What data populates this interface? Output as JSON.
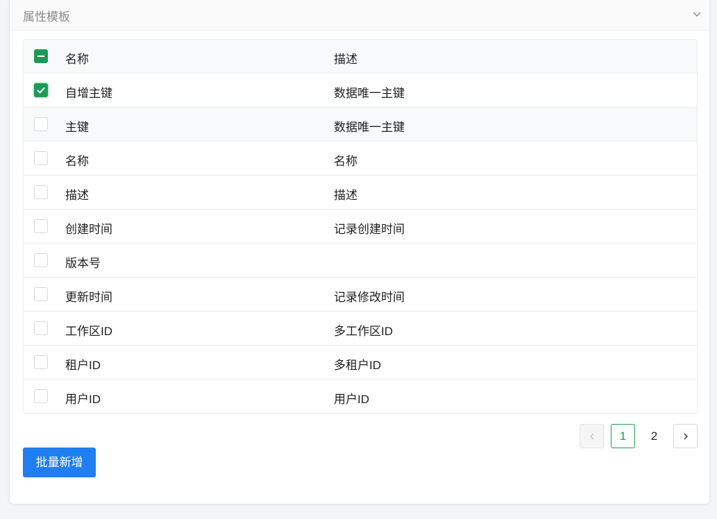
{
  "panel": {
    "title": "属性模板",
    "collapse_icon": "chevron-down-icon"
  },
  "table": {
    "columns": {
      "name": "名称",
      "desc": "描述"
    },
    "header_checkbox_state": "indeterminate",
    "rows": [
      {
        "name": "自增主键",
        "desc": "数据唯一主键",
        "checked": true
      },
      {
        "name": "主键",
        "desc": "数据唯一主键",
        "checked": false
      },
      {
        "name": "名称",
        "desc": "名称",
        "checked": false
      },
      {
        "name": "描述",
        "desc": "描述",
        "checked": false
      },
      {
        "name": "创建时间",
        "desc": "记录创建时间",
        "checked": false
      },
      {
        "name": "版本号",
        "desc": "",
        "checked": false
      },
      {
        "name": "更新时间",
        "desc": "记录修改时间",
        "checked": false
      },
      {
        "name": "工作区ID",
        "desc": "多工作区ID",
        "checked": false
      },
      {
        "name": "租户ID",
        "desc": "多租户ID",
        "checked": false
      },
      {
        "name": "用户ID",
        "desc": "用户ID",
        "checked": false
      }
    ]
  },
  "pagination": {
    "pages": [
      "1",
      "2"
    ],
    "current": "1",
    "prev_icon": "chevron-left-icon",
    "next_icon": "chevron-right-icon"
  },
  "actions": {
    "batch_add_label": "批量新增"
  },
  "colors": {
    "accent": "#1e9a57",
    "primary_button": "#1f7ff0"
  }
}
